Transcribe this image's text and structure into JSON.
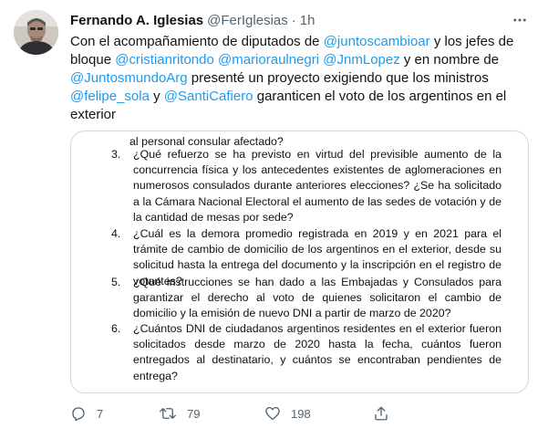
{
  "author": {
    "name": "Fernando A. Iglesias",
    "handle": "@FerIglesias",
    "separator": "·",
    "time": "1h"
  },
  "tweet": {
    "segments": [
      {
        "text": "Con el acompañamiento de diputados de ",
        "mention": false
      },
      {
        "text": "@juntoscambioar",
        "mention": true
      },
      {
        "text": " y los jefes de bloque ",
        "mention": false
      },
      {
        "text": "@cristianritondo",
        "mention": true
      },
      {
        "text": " ",
        "mention": false
      },
      {
        "text": "@marioraulnegri",
        "mention": true
      },
      {
        "text": " ",
        "mention": false
      },
      {
        "text": "@JnmLopez",
        "mention": true
      },
      {
        "text": " y en nombre de ",
        "mention": false
      },
      {
        "text": "@JuntosmundoArg",
        "mention": true
      },
      {
        "text": " presenté un proyecto exigiendo que los ministros ",
        "mention": false
      },
      {
        "text": "@felipe_sola",
        "mention": true
      },
      {
        "text": " y ",
        "mention": false
      },
      {
        "text": "@SantiCafiero",
        "mention": true
      },
      {
        "text": " garanticen el voto de los argentinos en el exterior",
        "mention": false
      }
    ]
  },
  "document": {
    "continuation": "al personal consular afectado?",
    "items": [
      {
        "num": "3.",
        "text": "¿Qué refuerzo se ha previsto en virtud del previsible aumento de la concurrencia física y los antecedentes existentes de aglomeraciones en numerosos consulados durante anteriores elecciones? ¿Se ha solicitado a la Cámara Nacional Electoral el aumento de las sedes de votación y de la cantidad de mesas por sede?"
      },
      {
        "num": "4.",
        "text": "¿Cuál es la demora promedio registrada en 2019 y en 2021 para el trámite de cambio de domicilio de los argentinos en el exterior, desde su solicitud hasta la entrega del documento y la inscripción en el registro de votantes?"
      },
      {
        "num": "5.",
        "text": "¿Qué instrucciones se han dado a las Embajadas y Consulados para garantizar el derecho al voto de quienes solicitaron el cambio de domicilio y la emisión de nuevo DNI a partir de marzo de 2020?"
      },
      {
        "num": "6.",
        "text": "¿Cuántos DNI de ciudadanos argentinos residentes en el exterior fueron solicitados desde marzo de 2020 hasta la fecha, cuántos fueron entregados al destinatario, y cuántos se encontraban pendientes de entrega?"
      }
    ]
  },
  "actions": {
    "reply_count": "7",
    "retweet_count": "79",
    "like_count": "198"
  },
  "icons": {
    "more": "more-horizontal-icon",
    "reply": "reply-icon",
    "retweet": "retweet-icon",
    "like": "heart-icon",
    "share": "share-icon"
  },
  "colors": {
    "mention": "#1d9bf0",
    "secondary_text": "#536471",
    "primary_text": "#0f1419",
    "border": "#cfd9de"
  }
}
